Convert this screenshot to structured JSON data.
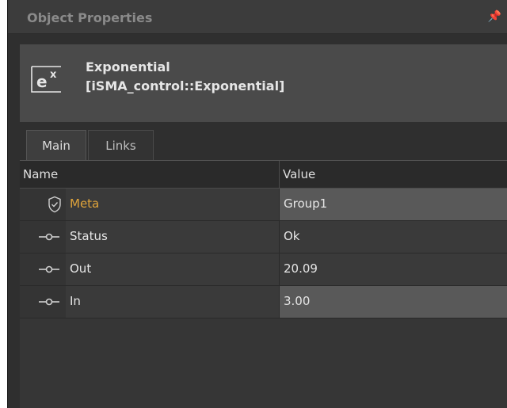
{
  "panel": {
    "title": "Object Properties",
    "pin_glyph": "⤂"
  },
  "object": {
    "icon_base": "e",
    "icon_exp": "x",
    "name": "Exponential",
    "type": "[iSMA_control::Exponential]"
  },
  "tabs": [
    {
      "label": "Main",
      "active": true
    },
    {
      "label": "Links",
      "active": false
    }
  ],
  "table": {
    "headers": {
      "name": "Name",
      "value": "Value"
    },
    "rows": [
      {
        "icon": "shield-icon",
        "name": "Meta",
        "value": "Group1",
        "editable": true
      },
      {
        "icon": "slot-icon",
        "name": "Status",
        "value": "Ok",
        "editable": false
      },
      {
        "icon": "slot-icon",
        "name": "Out",
        "value": "20.09",
        "editable": false
      },
      {
        "icon": "slot-icon",
        "name": "In",
        "value": "3.00",
        "editable": true
      }
    ]
  },
  "colors": {
    "meta_accent": "#e0a43a",
    "panel_bg": "#2f2f2f",
    "header_bg": "#4a4a4a"
  }
}
